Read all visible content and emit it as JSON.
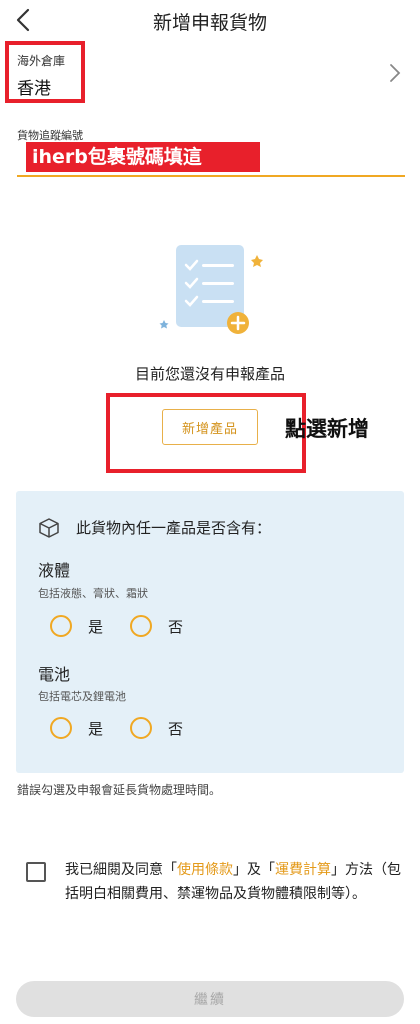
{
  "header": {
    "title": "新增申報貨物"
  },
  "warehouse": {
    "label": "海外倉庫",
    "value": "香港"
  },
  "tracking": {
    "label": "貨物追蹤編號",
    "annotation": "iherb包裹號碼填這"
  },
  "empty_state": {
    "message": "目前您還沒有申報產品",
    "add_button": "新增產品",
    "annotation": "點選新增"
  },
  "contents_check": {
    "title": "此貨物內任一產品是否含有：",
    "sections": [
      {
        "name": "液體",
        "desc": "包括液態、膏狀、霜狀",
        "yes": "是",
        "no": "否"
      },
      {
        "name": "電池",
        "desc": "包括電芯及鋰電池",
        "yes": "是",
        "no": "否"
      }
    ]
  },
  "warning": "錯誤勾選及申報會延長貨物處理時間。",
  "terms": {
    "prefix": "我已細閱及同意「",
    "link1": "使用條款",
    "middle": "」及「",
    "link2": "運費計算",
    "suffix": "」方法（包括明白相關費用、禁運物品及貨物體積限制等）。"
  },
  "continue_button": "繼續",
  "colors": {
    "accent": "#f0a823",
    "annotation_red": "#e8202b",
    "panel_bg": "#e4f0f8"
  }
}
